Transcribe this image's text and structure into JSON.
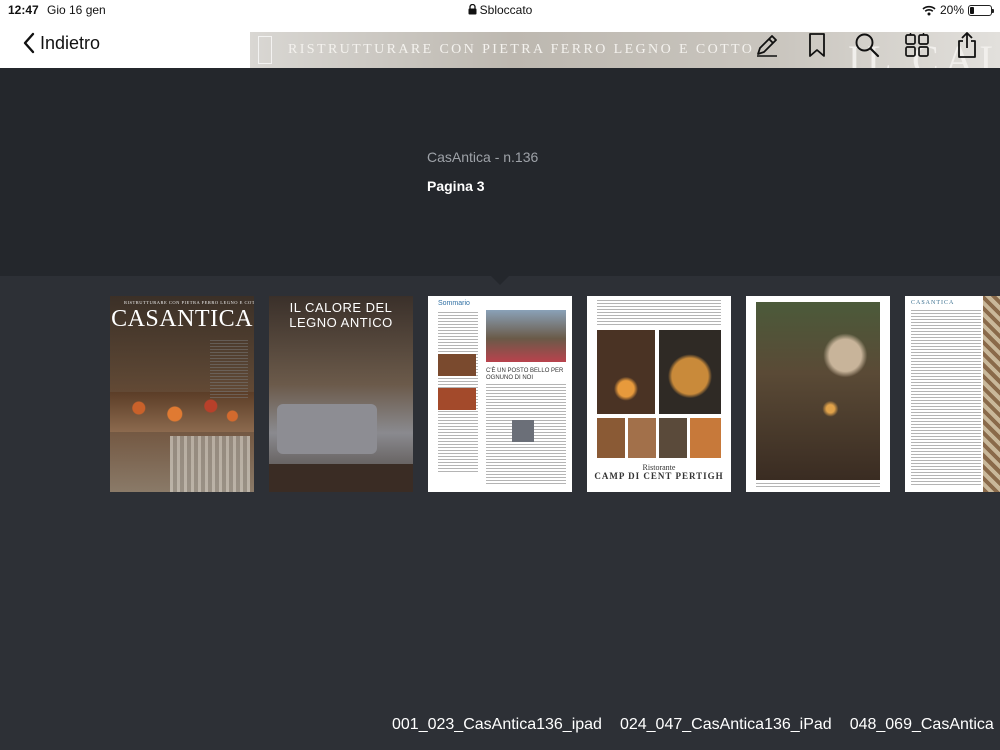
{
  "status_bar": {
    "time": "12:47",
    "date": "Gio 16 gen",
    "lock_status": "Sbloccato",
    "battery_percent": "20%",
    "battery_level": 0.2
  },
  "nav": {
    "back_label": "Indietro",
    "banner_text": "RISTRUTTURARE CON PIETRA FERRO LEGNO E COTTO",
    "banner_big": "IL CAL",
    "icons": [
      "annotate-icon",
      "bookmark-icon",
      "search-icon",
      "grid-icon",
      "share-icon"
    ]
  },
  "document": {
    "title": "CasAntica - n.136",
    "page": "Pagina 3"
  },
  "thumbnails": {
    "t1": {
      "masthead": "CASANTICA",
      "tagline": "RISTRUTTURARE CON PIETRA FERRO LEGNO E COTTO"
    },
    "t2": {
      "heading": "IL CALORE DEL LEGNO ANTICO"
    },
    "t3": {
      "section": "Sommario",
      "headline": "C'È UN POSTO BELLO PER OGNUNO DI NOI"
    },
    "t4": {
      "restaurant_line1": "Ristorante",
      "restaurant_line2": "CAMP DI CENT PERTIGH"
    },
    "t6": {
      "masthead": "CASANTICA"
    }
  },
  "files": [
    "001_023_CasAntica136_ipad",
    "024_047_CasAntica136_iPad",
    "048_069_CasAntica"
  ]
}
